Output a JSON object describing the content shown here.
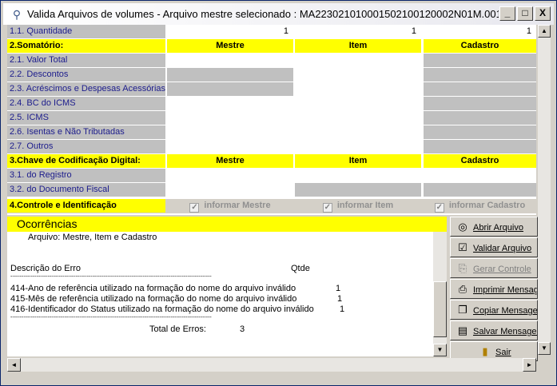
{
  "window": {
    "title": "Valida Arquivos de volumes - Arquivo mestre selecionado : MA223021010001502100120002N01M.001  - Validad...",
    "minimize": "_",
    "maximize": "□",
    "close": "X"
  },
  "grid": {
    "quantidade": {
      "label": "1.1. Quantidade",
      "mestre": "1",
      "item": "1",
      "cadastro": "1"
    },
    "somatorio": {
      "header": "2.Somatório:",
      "col_mestre": "Mestre",
      "col_item": "Item",
      "col_cadastro": "Cadastro",
      "rows": [
        "2.1. Valor Total",
        "2.2. Descontos",
        "2.3. Acréscimos e Despesas Acessórias",
        "2.4. BC do ICMS",
        "2.5. ICMS",
        "2.6. Isentas e Não Tributadas",
        "2.7. Outros"
      ]
    },
    "chave": {
      "header": "3.Chave de Codificação Digital:",
      "col_mestre": "Mestre",
      "col_item": "Item",
      "col_cadastro": "Cadastro",
      "rows": [
        "3.1. do Registro",
        "3.2. do Documento Fiscal"
      ]
    },
    "controle": {
      "header": "4.Controle e Identificação",
      "informar_mestre": "informar Mestre",
      "informar_item": "informar Item",
      "informar_cadastro": "informar Cadastro",
      "check": "✓"
    }
  },
  "ocorrencias": {
    "title": "Ocorrências",
    "arquivo": "Arquivo: Mestre, Item e Cadastro",
    "desc_header": "Descrição do Erro",
    "qtde_header": "Qtde",
    "separator": "------------------------------------------------------------------------------------------------------------",
    "errors": [
      {
        "text": "414-Ano de referência utilizado na formação do nome do arquivo inválido",
        "qtde": "1"
      },
      {
        "text": "415-Mês de referência utilizado na formação do nome do arquivo inválido",
        "qtde": "1"
      },
      {
        "text": "416-Identificador do Status utilizado na formação do nome do arquivo inválido",
        "qtde": "1"
      }
    ],
    "total_label": "Total de Erros:",
    "total_value": "3"
  },
  "buttons": {
    "abrir": "Abrir Arquivo",
    "validar": "Validar Arquivo",
    "gerar": "Gerar Controle",
    "imprimir": "Imprimir Mensagens",
    "copiar": "Copiar Mensagens",
    "salvar": "Salvar Mensagens",
    "sair": "Sair"
  },
  "scroll": {
    "up": "▲",
    "down": "▼",
    "left": "◄",
    "right": "►"
  }
}
